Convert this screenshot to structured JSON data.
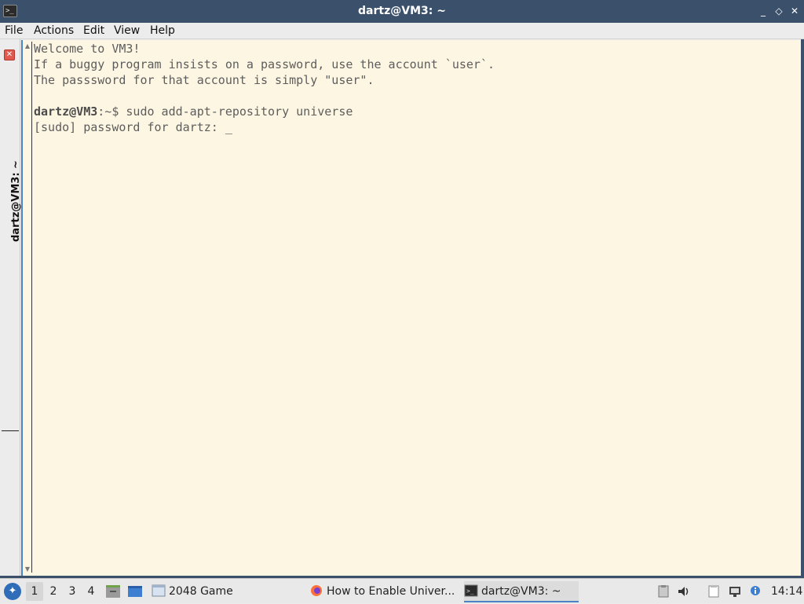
{
  "window": {
    "title": "dartz@VM3: ~",
    "minimize": "_",
    "maximize": "◇",
    "close": "✕"
  },
  "menu": [
    "File",
    "Actions",
    "Edit",
    "View",
    "Help"
  ],
  "tab": {
    "label": "dartz@VM3: ~"
  },
  "terminal": {
    "welcome": "Welcome to VM3!",
    "info1": "If a buggy program insists on a password, use the account `user`.",
    "info2": "The passsword for that account is simply \"user\".",
    "prompt": "dartz@VM3",
    "prompt_path": ":~$ ",
    "command": "sudo add-apt-repository universe",
    "sudo_prompt": "[sudo] password for dartz: ",
    "cursor": "_"
  },
  "taskbar": {
    "workspaces": [
      "1",
      "2",
      "3",
      "4"
    ],
    "tasks": [
      {
        "label": "2048 Game",
        "icon": "window-icon"
      },
      {
        "label": "How to Enable Univer...",
        "icon": "firefox-icon"
      },
      {
        "label": "dartz@VM3: ~",
        "icon": "terminal-icon"
      }
    ],
    "clock": "14:14"
  },
  "colors": {
    "titlebar": "#3a506b",
    "terminal_bg": "#fdf6e3",
    "terminal_text": "#5d5d5d",
    "accent": "#4a84c4"
  }
}
